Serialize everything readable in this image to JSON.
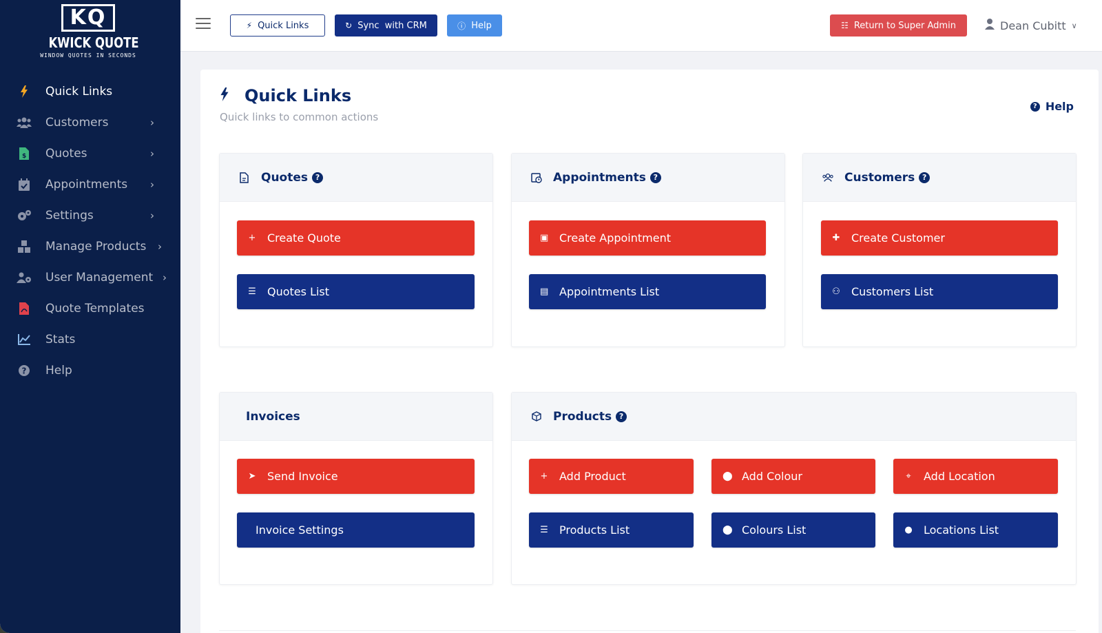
{
  "brand": {
    "mark": "KQ",
    "name": "KWICK QUOTE",
    "tagline": "WINDOW QUOTES IN SECONDS"
  },
  "sidebar": {
    "items": [
      {
        "label": "Quick Links",
        "icon": "bolt-icon",
        "active": true
      },
      {
        "label": "Customers",
        "icon": "users-icon",
        "has_submenu": true
      },
      {
        "label": "Quotes",
        "icon": "file-dollar-icon",
        "has_submenu": true
      },
      {
        "label": "Appointments",
        "icon": "calendar-check-icon",
        "has_submenu": true
      },
      {
        "label": "Settings",
        "icon": "gears-icon",
        "has_submenu": true
      },
      {
        "label": "Manage Products",
        "icon": "boxes-icon",
        "has_submenu": true
      },
      {
        "label": "User Management",
        "icon": "user-gear-icon",
        "has_submenu": true
      },
      {
        "label": "Quote Templates",
        "icon": "file-pdf-icon"
      },
      {
        "label": "Stats",
        "icon": "chart-line-icon"
      },
      {
        "label": "Help",
        "icon": "question-circle-icon"
      }
    ]
  },
  "topbar": {
    "quick_links": "Quick Links",
    "sync": "Sync  with CRM",
    "help": "Help",
    "return_admin": "Return to Super Admin",
    "user_name": "Dean Cubitt"
  },
  "page": {
    "title": "Quick Links",
    "subtitle": "Quick links to common actions",
    "help": "Help"
  },
  "cards": {
    "quotes": {
      "title": "Quotes",
      "create": "Create Quote",
      "list": "Quotes List"
    },
    "appointments": {
      "title": "Appointments",
      "create": "Create Appointment",
      "list": "Appointments List"
    },
    "customers": {
      "title": "Customers",
      "create": "Create Customer",
      "list": "Customers List"
    },
    "invoices": {
      "title": "Invoices",
      "send": "Send Invoice",
      "settings": "Invoice Settings"
    },
    "products": {
      "title": "Products",
      "add_product": "Add Product",
      "add_colour": "Add Colour",
      "add_location": "Add Location",
      "products_list": "Products List",
      "colours_list": "Colours List",
      "locations_list": "Locations List"
    }
  },
  "colors": {
    "sidebar_bg": "#0b1f49",
    "primary_red": "#e53428",
    "primary_blue": "#132f86",
    "help_blue": "#4a8fe7",
    "admin_red": "#dc4c4f"
  }
}
